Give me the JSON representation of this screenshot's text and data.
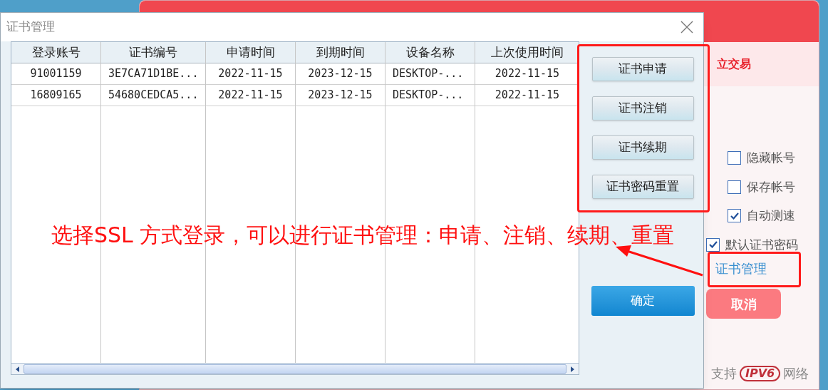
{
  "background_window": {
    "banner_text": "立交易",
    "options": [
      {
        "label": "隐藏帐号",
        "checked": false
      },
      {
        "label": "保存帐号",
        "checked": false
      },
      {
        "label": "自动测速",
        "checked": true
      },
      {
        "label": "默认证书密码",
        "checked": true
      }
    ],
    "cert_link": "证书管理",
    "cancel_button": "取消",
    "footer": {
      "prefix": "支持",
      "badge": "IPV6",
      "suffix": "网络"
    }
  },
  "dialog": {
    "title": "证书管理",
    "table": {
      "columns": [
        "登录账号",
        "证书编号",
        "申请时间",
        "到期时间",
        "设备名称",
        "上次使用时间"
      ],
      "rows": [
        [
          "91001159",
          "3E7CA71D1BE...",
          "2022-11-15",
          "2023-12-15",
          "DESKTOP-...",
          "2022-11-15"
        ],
        [
          "16809165",
          "54680CEDCA5...",
          "2022-11-15",
          "2023-12-15",
          "DESKTOP-...",
          "2022-11-15"
        ]
      ]
    },
    "buttons": [
      "证书申请",
      "证书注销",
      "证书续期",
      "证书密码重置"
    ],
    "ok_button": "确定"
  },
  "annotation": {
    "text": "选择SSL 方式登录，可以进行证书管理：申请、注销、续期、重置"
  }
}
